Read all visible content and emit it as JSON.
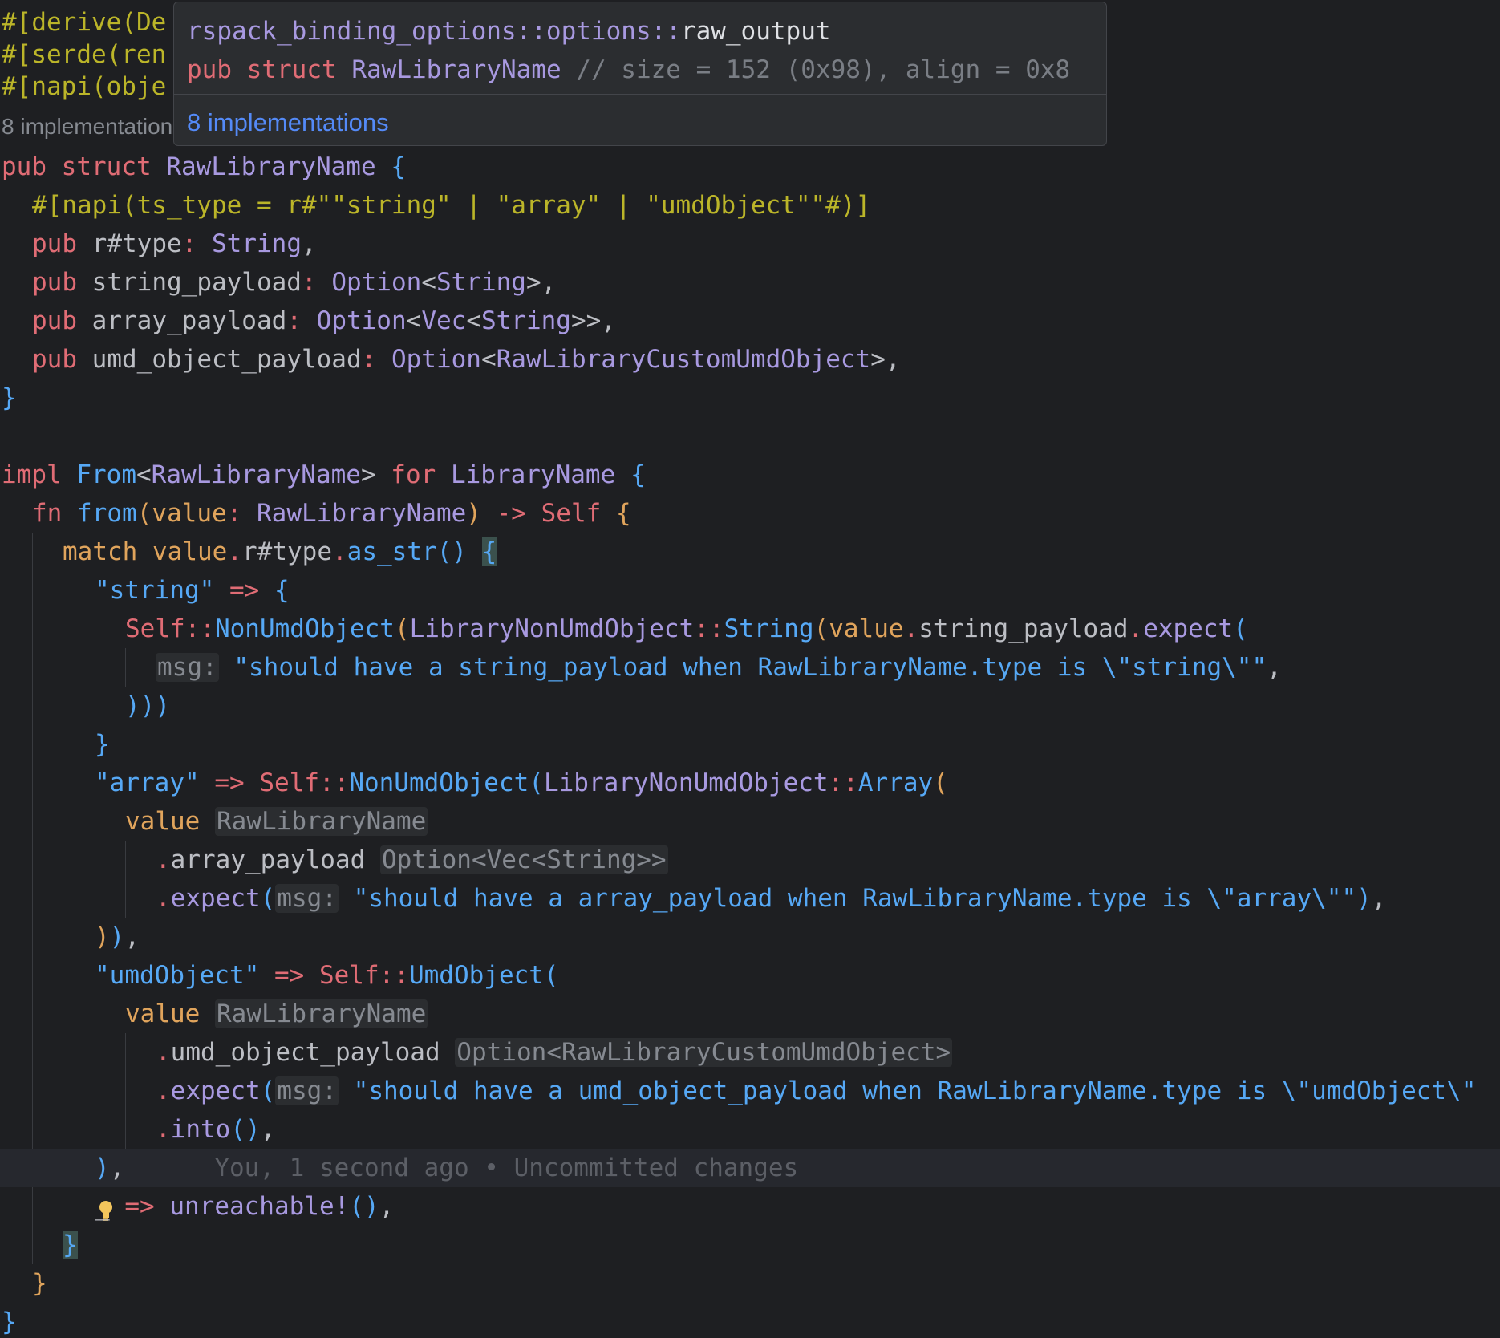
{
  "tooltip": {
    "path_prefix": "rspack_binding_options::options::",
    "path_name": "raw_output",
    "sig_pub": "pub",
    "sig_struct": "struct",
    "sig_name": "RawLibraryName",
    "sig_comment": "// size = 152 (0x98), align = 0x8",
    "implementations": "8 implementations"
  },
  "lens": {
    "implementations": "8 implementations"
  },
  "blame": "You, 1 second ago • Uncommitted changes",
  "hints": {
    "msg": "msg:",
    "raw_library_name": "RawLibraryName",
    "option_vec_string": "Option<Vec<String>>",
    "option_custom_umd": "Option<RawLibraryCustomUmdObject>"
  },
  "code": {
    "derive": "#[derive(De",
    "serde": "#[serde(ren",
    "napi": "#[napi(obje",
    "struct_name": "RawLibraryName",
    "ts_type_attr": "#[napi(ts_type = r#\"\"string\" | \"array\" | \"umdObject\"\"#)]",
    "field_type": "r#type",
    "field_string_payload": "string_payload",
    "field_array_payload": "array_payload",
    "field_umd_payload": "umd_object_payload",
    "t_string": "String",
    "t_option": "Option",
    "t_vec": "Vec",
    "t_custom_umd": "RawLibraryCustomUmdObject",
    "t_from": "From",
    "t_library_name": "LibraryName",
    "t_self": "Self",
    "fn_from": "from",
    "param_value": "value",
    "method_as_str": "as_str",
    "case_string": "\"string\"",
    "case_array": "\"array\"",
    "case_umd": "\"umdObject\"",
    "v_non_umd": "NonUmdObject",
    "v_umd": "UmdObject",
    "t_non_umd_enum": "LibraryNonUmdObject",
    "v_string": "String",
    "v_array": "Array",
    "method_expect": "expect",
    "method_into": "into",
    "msg_string": "\"should have a string_payload when RawLibraryName.type is \\\"string\\\"\"",
    "msg_array": "\"should have a array_payload when RawLibraryName.type is \\\"array\\\"\"",
    "msg_umd": "\"should have a umd_object_payload when RawLibraryName.type is \\\"umdObject\\\"",
    "macro_unreachable": "unreachable!"
  },
  "colors": {
    "background": "#1e1f22",
    "keyword": "#e06c75",
    "type": "#a899e0",
    "function": "#56a8f5",
    "string": "#6aab73",
    "parameter": "#e0a45c",
    "link": "#548af7"
  }
}
